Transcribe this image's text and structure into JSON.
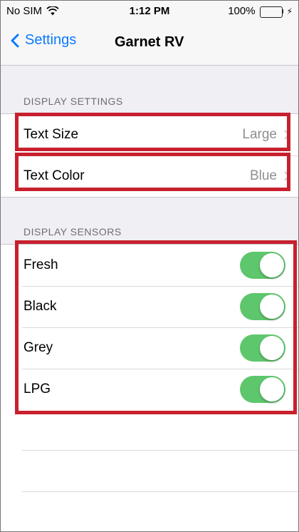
{
  "status_bar": {
    "carrier": "No SIM",
    "wifi_icon": "wifi-icon",
    "time": "1:12 PM",
    "battery_percent": "100%",
    "battery_level": 1.0,
    "battery_color": "#4cd964",
    "charging_icon": "bolt-icon"
  },
  "nav": {
    "back_label": "Settings",
    "back_icon": "chevron-left-icon",
    "title": "Garnet RV",
    "accent_color": "#0a7aff"
  },
  "display_settings": {
    "header": "DISPLAY SETTINGS",
    "rows": [
      {
        "label": "Text Size",
        "value": "Large"
      },
      {
        "label": "Text Color",
        "value": "Blue"
      }
    ]
  },
  "display_sensors": {
    "header": "DISPLAY SENSORS",
    "rows": [
      {
        "label": "Fresh",
        "on": true
      },
      {
        "label": "Black",
        "on": true
      },
      {
        "label": "Grey",
        "on": true
      },
      {
        "label": "LPG",
        "on": true
      }
    ],
    "toggle_color": "#5ec66c"
  },
  "annotation_color": "#c8202e"
}
